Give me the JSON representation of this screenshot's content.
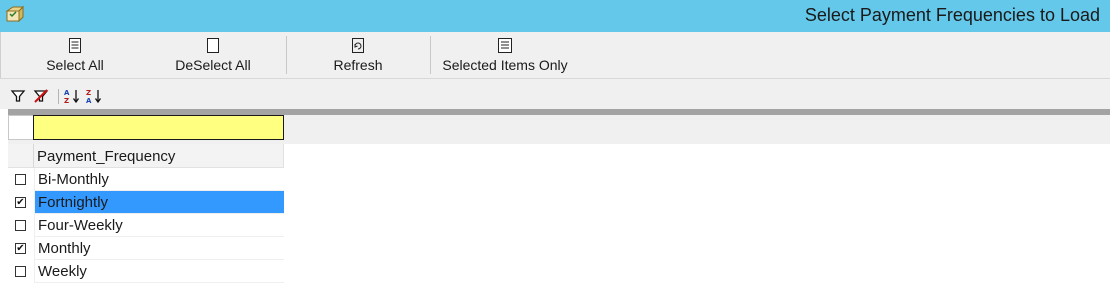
{
  "window": {
    "title": "Select Payment Frequencies to Load",
    "app_icon": "app-icon"
  },
  "toolbar": {
    "buttons": [
      {
        "label": "Select All",
        "icon": "select-all-icon"
      },
      {
        "label": "DeSelect All",
        "icon": "deselect-all-icon"
      },
      {
        "label": "Refresh",
        "icon": "refresh-icon"
      },
      {
        "label": "Selected Items Only",
        "icon": "selected-items-icon"
      }
    ]
  },
  "filterbar": {
    "icons": [
      "filter-icon",
      "clear-filter-icon",
      "sort-ascending-icon",
      "sort-descending-icon"
    ]
  },
  "grid": {
    "filter_value": "",
    "column_header": "Payment_Frequency",
    "rows": [
      {
        "label": "Bi-Monthly",
        "checked": false,
        "selected": false
      },
      {
        "label": "Fortnightly",
        "checked": true,
        "selected": true
      },
      {
        "label": "Four-Weekly",
        "checked": false,
        "selected": false
      },
      {
        "label": "Monthly",
        "checked": true,
        "selected": false
      },
      {
        "label": "Weekly",
        "checked": false,
        "selected": false
      }
    ]
  },
  "colors": {
    "titlebar": "#64c8ea",
    "selection": "#3399ff",
    "filter_cell": "#ffff80"
  }
}
